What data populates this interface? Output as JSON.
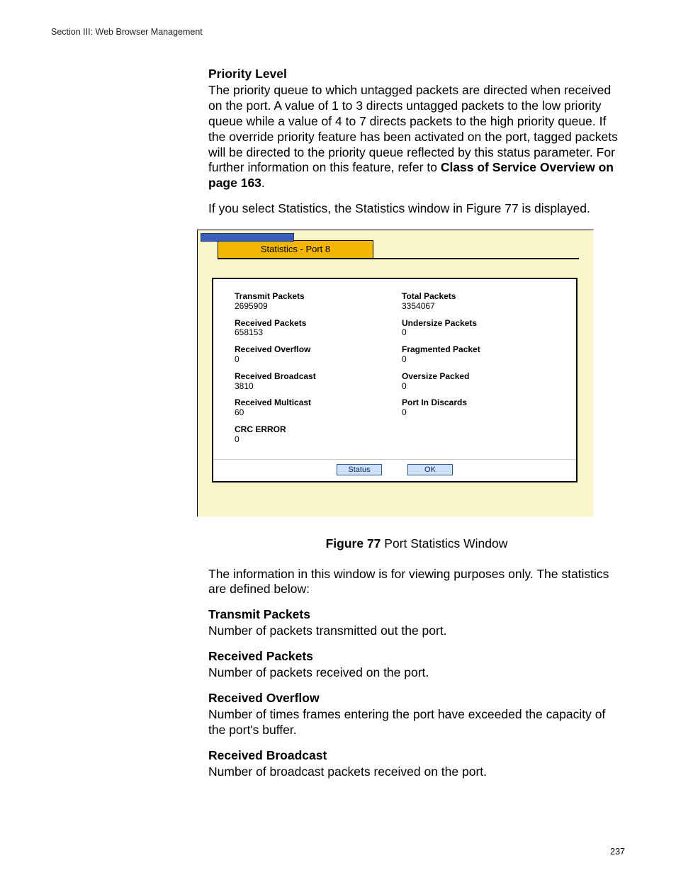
{
  "header": "Section III: Web Browser Management",
  "page_number": "237",
  "heading_priority": "Priority Level",
  "para_priority": "The priority queue to which untagged packets are directed when received on the port. A value of 1 to 3 directs untagged packets to the low priority queue while a value of 4 to 7 directs packets to the high priority queue. If the override priority feature has been activated on the port, tagged packets will be directed to the priority queue reflected by this status parameter. For further information on this feature, refer to ",
  "para_priority_link": "Class of Service Overview on page 163",
  "para_priority_end": ".",
  "para_figure_intro": "If you select Statistics, the Statistics window in Figure 77 is displayed.",
  "figure": {
    "title": "Statistics - Port 8",
    "buttons": {
      "status": "Status",
      "ok": "OK"
    },
    "left": [
      {
        "label": "Transmit Packets",
        "value": "2695909"
      },
      {
        "label": "Received Packets",
        "value": "658153"
      },
      {
        "label": "Received Overflow",
        "value": "0"
      },
      {
        "label": "Received Broadcast",
        "value": "3810"
      },
      {
        "label": "Received Multicast",
        "value": "60"
      },
      {
        "label": "CRC ERROR",
        "value": "0"
      }
    ],
    "right": [
      {
        "label": "Total Packets",
        "value": "3354067"
      },
      {
        "label": "Undersize Packets",
        "value": "0"
      },
      {
        "label": "Fragmented Packet",
        "value": "0"
      },
      {
        "label": "Oversize Packed",
        "value": "0"
      },
      {
        "label": "Port In Discards",
        "value": "0"
      }
    ]
  },
  "figure_caption_bold": "Figure 77",
  "figure_caption_rest": "  Port Statistics Window",
  "para_viewing": "The information in this window is for viewing purposes only. The statistics are defined below:",
  "defs": [
    {
      "term": "Transmit Packets",
      "desc": "Number of packets transmitted out the port."
    },
    {
      "term": "Received Packets",
      "desc": "Number of packets received on the port."
    },
    {
      "term": "Received Overflow",
      "desc": "Number of times frames entering the port have exceeded the capacity of the port's buffer."
    },
    {
      "term": "Received Broadcast",
      "desc": "Number of broadcast packets received on the port."
    }
  ]
}
